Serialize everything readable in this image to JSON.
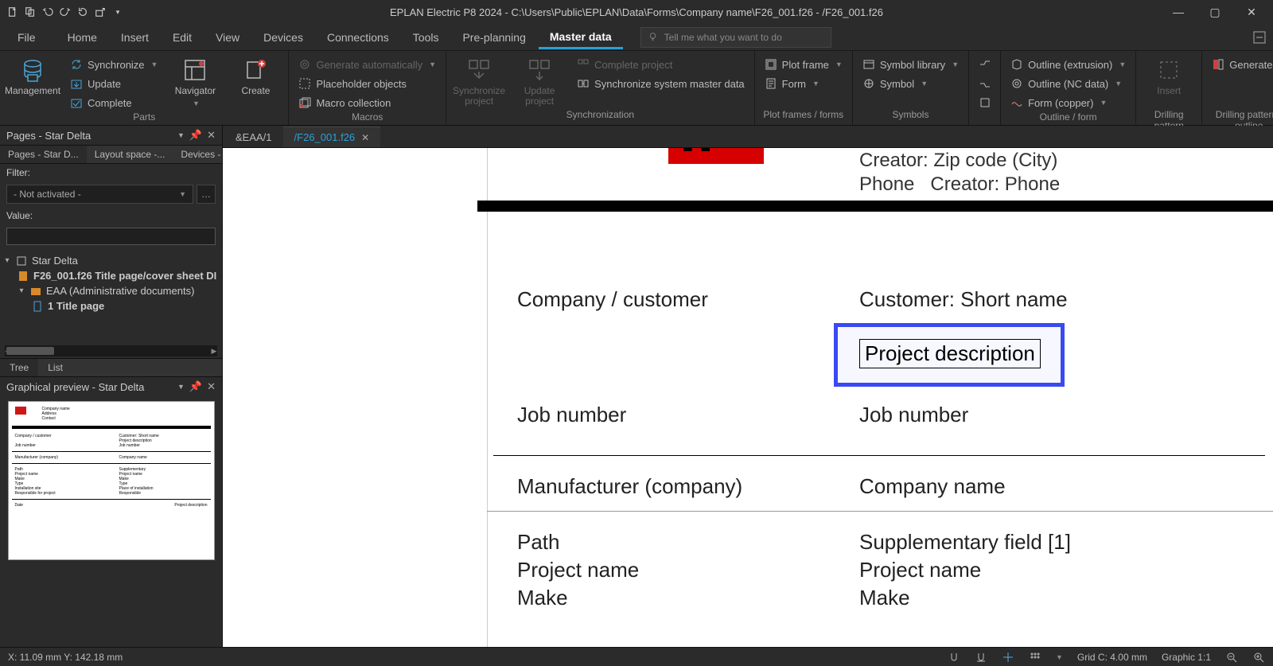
{
  "title": "EPLAN Electric P8 2024 - C:\\Users\\Public\\EPLAN\\Data\\Forms\\Company name\\F26_001.f26 - /F26_001.f26",
  "menus": {
    "file": "File",
    "home": "Home",
    "insert": "Insert",
    "edit": "Edit",
    "view": "View",
    "devices": "Devices",
    "connections": "Connections",
    "tools": "Tools",
    "preplanning": "Pre-planning",
    "masterdata": "Master data"
  },
  "tellme_placeholder": "Tell me what you want to do",
  "ribbon": {
    "parts": {
      "management": "Management",
      "synchronize": "Synchronize",
      "update": "Update",
      "complete": "Complete",
      "navigator": "Navigator",
      "create": "Create",
      "group": "Parts"
    },
    "macros": {
      "gen_auto": "Generate automatically",
      "placeholder": "Placeholder objects",
      "macro_coll": "Macro collection",
      "group": "Macros"
    },
    "sync": {
      "sync_proj": "Synchronize project",
      "upd_proj": "Update project",
      "complete_proj": "Complete project",
      "sync_master": "Synchronize system master data",
      "group": "Synchronization"
    },
    "plot": {
      "plot_frame": "Plot frame",
      "form": "Form",
      "group": "Plot frames / forms"
    },
    "symbols": {
      "symlib": "Symbol library",
      "symbol": "Symbol",
      "group": "Symbols"
    },
    "outline": {
      "extrusion": "Outline (extrusion)",
      "ncdata": "Outline (NC data)",
      "copper": "Form (copper)",
      "group": "Outline / form"
    },
    "insertpic": {
      "insert": "Insert",
      "group": "Drilling pattern frame"
    },
    "drillout": {
      "generate": "Generate",
      "group": "Drilling pattern / outline"
    }
  },
  "doctabs": {
    "tab1": "&EAA/1",
    "tab2": "/F26_001.f26"
  },
  "pages_panel": {
    "title": "Pages - Star Delta",
    "inner_tabs": {
      "a": "Pages - Star D...",
      "b": "Layout space -...",
      "c": "Devices - Star ..."
    },
    "filter_label": "Filter:",
    "filter_value": "- Not activated -",
    "value_label": "Value:",
    "tree": {
      "root": "Star Delta",
      "n1": "F26_001.f26 Title page/cover sheet DI",
      "n2": "EAA (Administrative documents)",
      "n3": "1 Title page"
    },
    "bottom": {
      "tree": "Tree",
      "list": "List"
    }
  },
  "preview_panel": {
    "title": "Graphical preview - Star Delta"
  },
  "canvas": {
    "creator_zip": "Creator: Zip code (City)",
    "phone": "Phone",
    "creator_phone": "Creator: Phone",
    "company_customer": "Company / customer",
    "customer_short": "Customer: Short name",
    "project_desc": "Project description",
    "job_number_l": "Job number",
    "job_number_r": "Job number",
    "manufacturer": "Manufacturer (company)",
    "company_name": "Company name",
    "path": "Path",
    "supp_field": "Supplementary field [1]",
    "project_name_l": "Project name",
    "project_name_r": "Project name",
    "make_l": "Make",
    "make_r": "Make"
  },
  "status": {
    "coords": "X: 11.09 mm Y: 142.18 mm",
    "grid": "Grid C: 4.00 mm",
    "graphic": "Graphic 1:1"
  }
}
